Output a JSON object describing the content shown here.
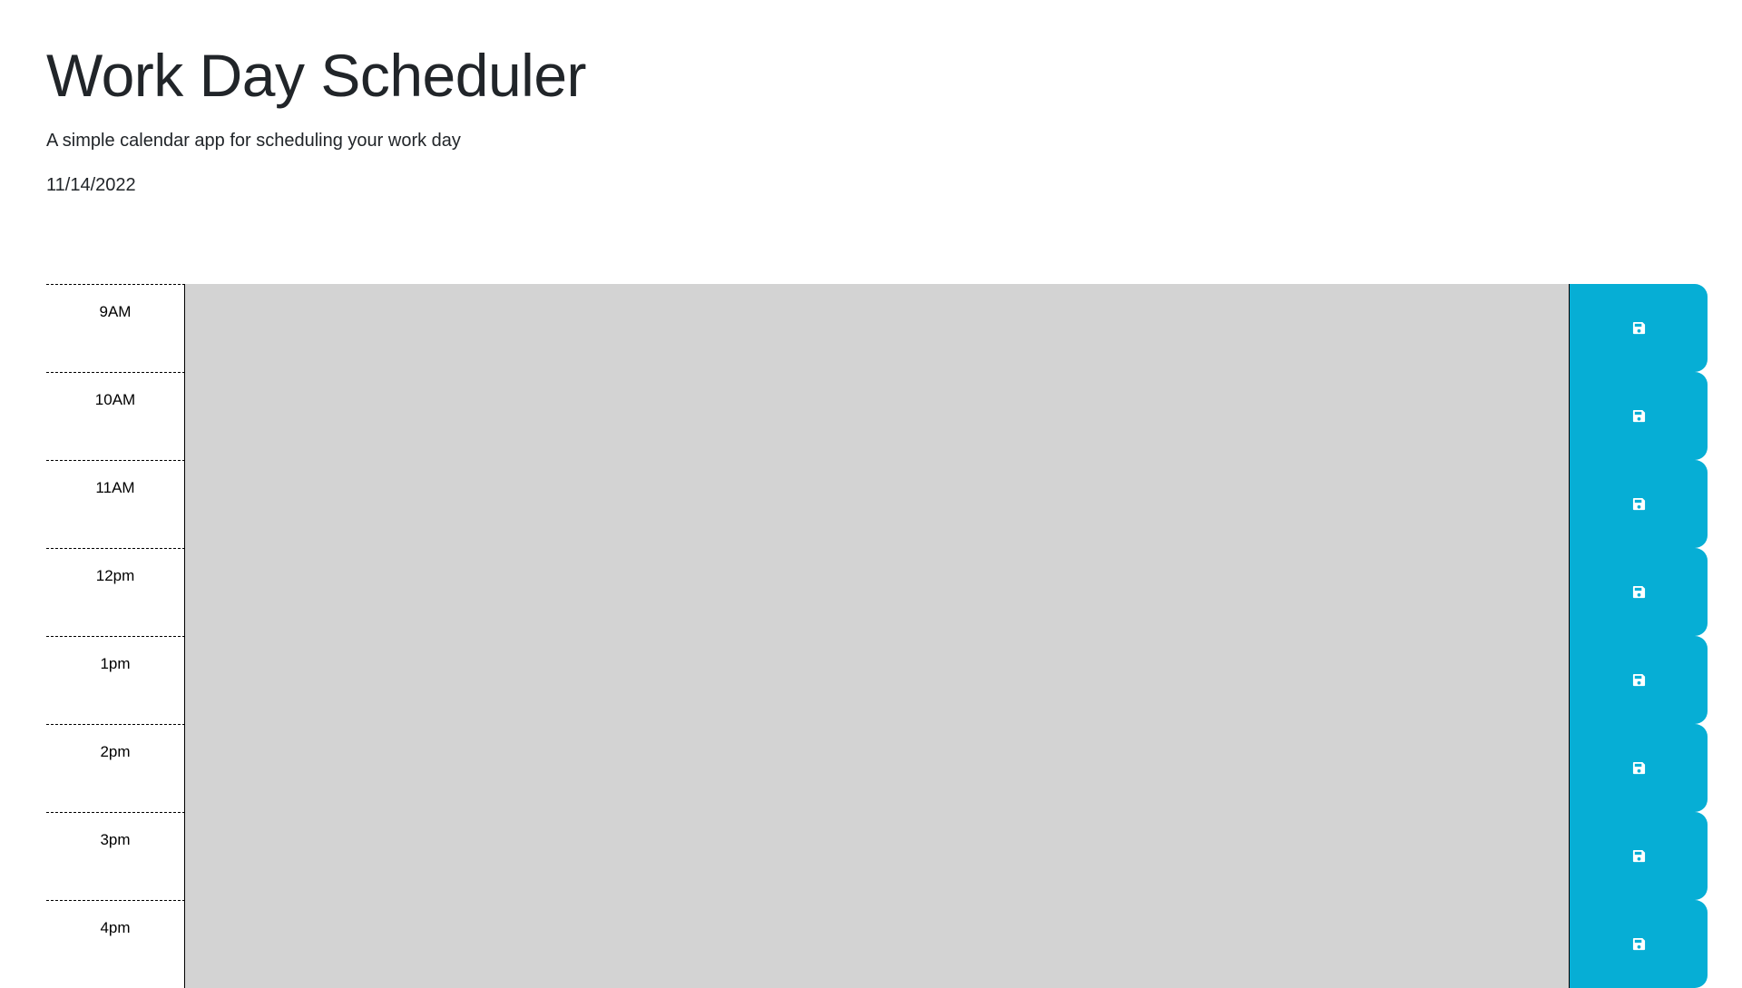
{
  "header": {
    "title": "Work Day Scheduler",
    "subtitle": "A simple calendar app for scheduling your work day",
    "date": "11/14/2022"
  },
  "schedule": {
    "hours": [
      {
        "label": "9AM",
        "text": ""
      },
      {
        "label": "10AM",
        "text": ""
      },
      {
        "label": "11AM",
        "text": ""
      },
      {
        "label": "12pm",
        "text": ""
      },
      {
        "label": "1pm",
        "text": ""
      },
      {
        "label": "2pm",
        "text": ""
      },
      {
        "label": "3pm",
        "text": ""
      },
      {
        "label": "4pm",
        "text": ""
      }
    ],
    "save_icon": "floppy-disk-icon"
  },
  "colors": {
    "past_block": "#d3d3d3",
    "save_button": "#06aed5",
    "icon": "#ffffff"
  }
}
